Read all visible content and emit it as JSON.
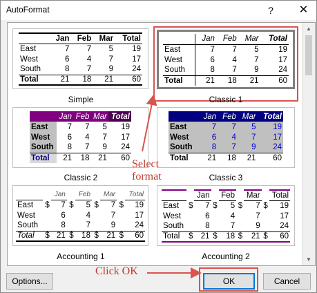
{
  "dialog": {
    "title": "AutoFormat",
    "help_glyph": "?",
    "close_glyph": "✕"
  },
  "headers": [
    "",
    "Jan",
    "Feb",
    "Mar",
    "Total"
  ],
  "rows": [
    [
      "East",
      "7",
      "7",
      "5",
      "19"
    ],
    [
      "West",
      "6",
      "4",
      "7",
      "17"
    ],
    [
      "South",
      "8",
      "7",
      "9",
      "24"
    ],
    [
      "Total",
      "21",
      "18",
      "21",
      "60"
    ]
  ],
  "acc_rows": [
    [
      "East",
      "$",
      "7",
      "$",
      "5",
      "$",
      "7",
      "$",
      "19"
    ],
    [
      "West",
      "",
      "6",
      "",
      "4",
      "",
      "7",
      "",
      "17"
    ],
    [
      "South",
      "",
      "8",
      "",
      "7",
      "",
      "9",
      "",
      "24"
    ],
    [
      "Total",
      "$",
      "21",
      "$",
      "18",
      "$",
      "21",
      "$",
      "60"
    ]
  ],
  "formats": [
    {
      "name": "Simple"
    },
    {
      "name": "Classic 1"
    },
    {
      "name": "Classic 2"
    },
    {
      "name": "Classic 3"
    },
    {
      "name": "Accounting 1"
    },
    {
      "name": "Accounting 2"
    }
  ],
  "buttons": {
    "options": "Options...",
    "ok": "OK",
    "cancel": "Cancel"
  },
  "annotations": {
    "select": "Select\nformat",
    "click_ok": "Click OK"
  },
  "colors": {
    "classic2_header": "#800080",
    "classic3_header": "#000080",
    "classic3_text": "#0000cc",
    "highlight": "#d9534f"
  }
}
